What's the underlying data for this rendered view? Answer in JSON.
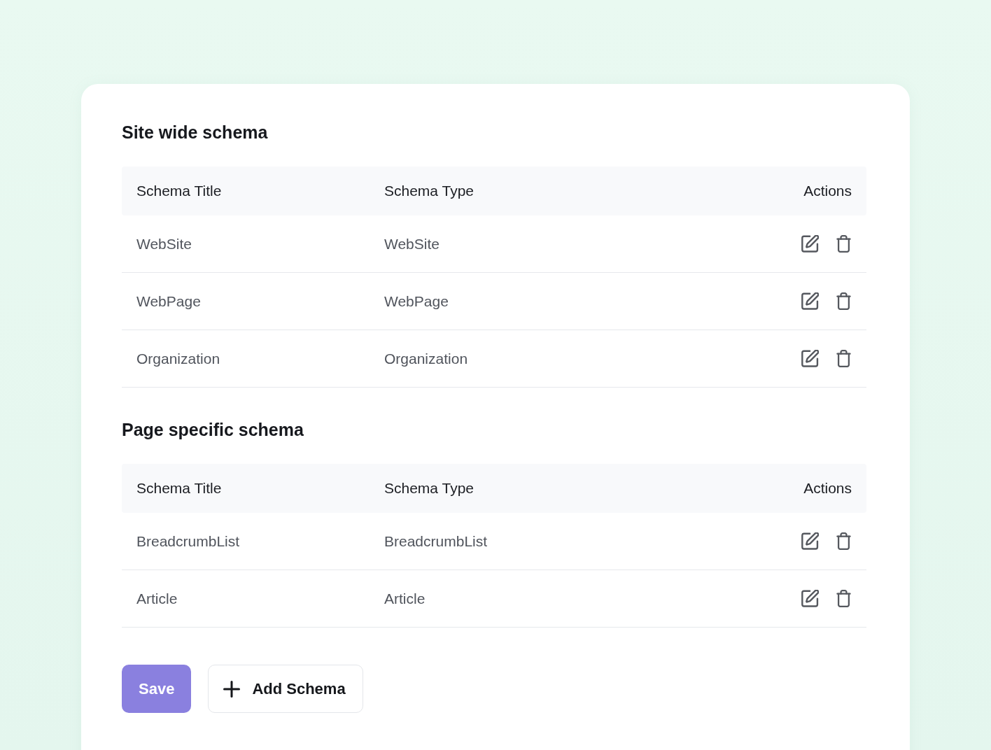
{
  "sections": [
    {
      "title": "Site wide schema",
      "columns": [
        "Schema Title",
        "Schema Type",
        "Actions"
      ],
      "rows": [
        {
          "title": "WebSite",
          "type": "WebSite"
        },
        {
          "title": "WebPage",
          "type": "WebPage"
        },
        {
          "title": "Organization",
          "type": "Organization"
        }
      ]
    },
    {
      "title": "Page specific schema",
      "columns": [
        "Schema Title",
        "Schema Type",
        "Actions"
      ],
      "rows": [
        {
          "title": "BreadcrumbList",
          "type": "BreadcrumbList"
        },
        {
          "title": "Article",
          "type": "Article"
        }
      ]
    }
  ],
  "buttons": [
    {
      "label": "Save",
      "kind": "primary"
    },
    {
      "label": "Add Schema",
      "kind": "add"
    }
  ]
}
